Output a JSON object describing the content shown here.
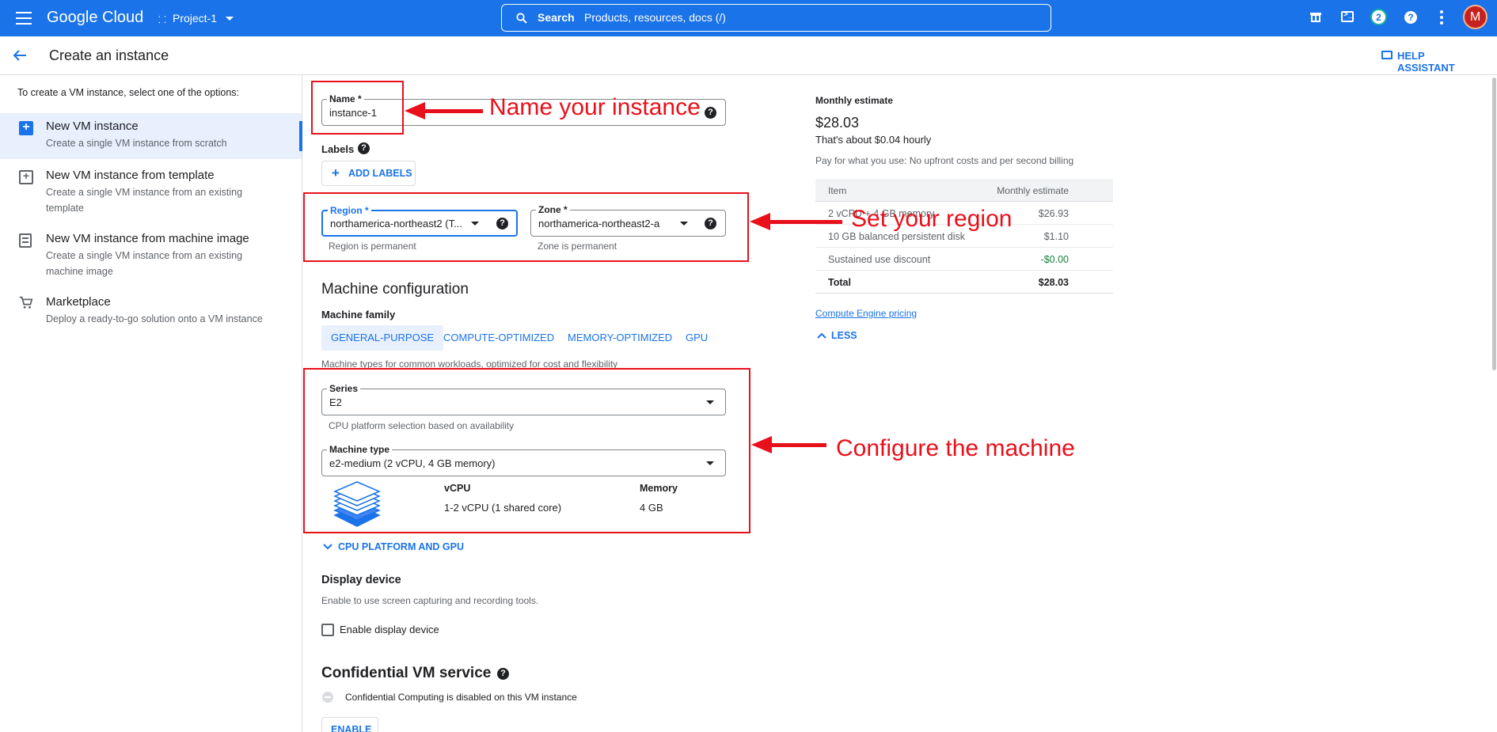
{
  "topbar": {
    "brand": "Google Cloud",
    "project": "Project-1",
    "search_label": "Search",
    "search_placeholder": "Products, resources, docs (/)",
    "notification_count": "2",
    "avatar_letter": "M"
  },
  "header": {
    "title": "Create an instance",
    "help_assistant": "HELP ASSISTANT"
  },
  "sidebar": {
    "intro": "To create a VM instance, select one of the options:",
    "items": [
      {
        "title": "New VM instance",
        "desc": "Create a single VM instance from scratch"
      },
      {
        "title": "New VM instance from template",
        "desc": "Create a single VM instance from an existing template"
      },
      {
        "title": "New VM instance from machine image",
        "desc": "Create a single VM instance from an existing machine image"
      },
      {
        "title": "Marketplace",
        "desc": "Deploy a ready-to-go solution onto a VM instance"
      }
    ]
  },
  "form": {
    "name_label": "Name *",
    "name_value": "instance-1",
    "labels_title": "Labels",
    "add_labels": "ADD LABELS",
    "region_label": "Region *",
    "region_value": "northamerica-northeast2 (T...",
    "region_hint": "Region is permanent",
    "zone_label": "Zone *",
    "zone_value": "northamerica-northeast2-a",
    "zone_hint": "Zone is permanent",
    "machine_config_title": "Machine configuration",
    "machine_family_label": "Machine family",
    "tabs": [
      "GENERAL-PURPOSE",
      "COMPUTE-OPTIMIZED",
      "MEMORY-OPTIMIZED",
      "GPU"
    ],
    "family_desc": "Machine types for common workloads, optimized for cost and flexibility",
    "series_label": "Series",
    "series_value": "E2",
    "series_hint": "CPU platform selection based on availability",
    "machine_type_label": "Machine type",
    "machine_type_value": "e2-medium (2 vCPU, 4 GB memory)",
    "vcpu_header": "vCPU",
    "vcpu_value": "1-2 vCPU (1 shared core)",
    "memory_header": "Memory",
    "memory_value": "4 GB",
    "cpu_platform_link": "CPU PLATFORM AND GPU",
    "display_device_title": "Display device",
    "display_device_desc": "Enable to use screen capturing and recording tools.",
    "enable_display_label": "Enable display device",
    "confidential_title": "Confidential VM service",
    "confidential_desc": "Confidential Computing is disabled on this VM instance",
    "enable_button": "ENABLE"
  },
  "estimate": {
    "title": "Monthly estimate",
    "price": "$28.03",
    "hourly": "That's about $0.04 hourly",
    "note": "Pay for what you use: No upfront costs and per second billing",
    "col_item": "Item",
    "col_estimate": "Monthly estimate",
    "rows": [
      {
        "item": "2 vCPU + 4 GB memory",
        "value": "$26.93"
      },
      {
        "item": "10 GB balanced persistent disk",
        "value": "$1.10"
      },
      {
        "item": "Sustained use discount",
        "value": "-$0.00"
      },
      {
        "item": "Total",
        "value": "$28.03"
      }
    ],
    "pricing_link": "Compute Engine pricing",
    "less": "LESS"
  },
  "annotations": {
    "name": "Name your instance",
    "region": "Set your region",
    "machine": "Configure the machine"
  },
  "colors": {
    "brand_blue": "#1a73e8",
    "annotation_red": "#e8101a",
    "discount_green": "#188038",
    "avatar_red": "#c5221f"
  }
}
